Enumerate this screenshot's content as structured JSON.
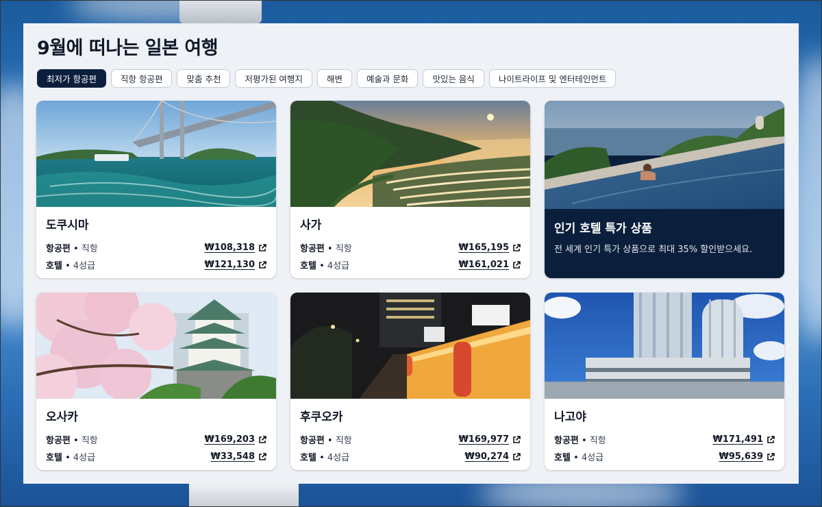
{
  "page": {
    "title": "9월에 떠나는 일본 여행"
  },
  "chips": [
    {
      "label": "최저가 항공편",
      "active": true
    },
    {
      "label": "직항 항공편",
      "active": false
    },
    {
      "label": "맞춤 추천",
      "active": false
    },
    {
      "label": "저평가된 여행지",
      "active": false
    },
    {
      "label": "해변",
      "active": false
    },
    {
      "label": "예술과 문화",
      "active": false
    },
    {
      "label": "맛있는 음식",
      "active": false
    },
    {
      "label": "나이트라이프 및 엔터테인먼트",
      "active": false
    }
  ],
  "cards": [
    {
      "city": "도쿠시마",
      "flight_label": "항공편",
      "flight_sub": "직항",
      "flight_price": "₩108,318",
      "hotel_label": "호텔",
      "hotel_sub": "4성급",
      "hotel_price": "₩121,130"
    },
    {
      "city": "사가",
      "flight_label": "항공편",
      "flight_sub": "직항",
      "flight_price": "₩165,195",
      "hotel_label": "호텔",
      "hotel_sub": "4성급",
      "hotel_price": "₩161,021"
    },
    {
      "city": "오사카",
      "flight_label": "항공편",
      "flight_sub": "직항",
      "flight_price": "₩169,203",
      "hotel_label": "호텔",
      "hotel_sub": "4성급",
      "hotel_price": "₩33,548"
    },
    {
      "city": "후쿠오카",
      "flight_label": "항공편",
      "flight_sub": "직항",
      "flight_price": "₩169,977",
      "hotel_label": "호텔",
      "hotel_sub": "4성급",
      "hotel_price": "₩90,274"
    },
    {
      "city": "나고야",
      "flight_label": "항공편",
      "flight_sub": "직항",
      "flight_price": "₩171,491",
      "hotel_label": "호텔",
      "hotel_sub": "4성급",
      "hotel_price": "₩95,639"
    }
  ],
  "promo": {
    "title": "인기 호텔 특가 상품",
    "description": "전 세계 인기 특가 상품으로 최대 35% 할인받으세요."
  },
  "separator": "•",
  "colors": {
    "accent_dark": "#0b1f3d",
    "panel_bg": "#eef1f6"
  },
  "icons": {
    "price_link": "external-link-icon"
  }
}
